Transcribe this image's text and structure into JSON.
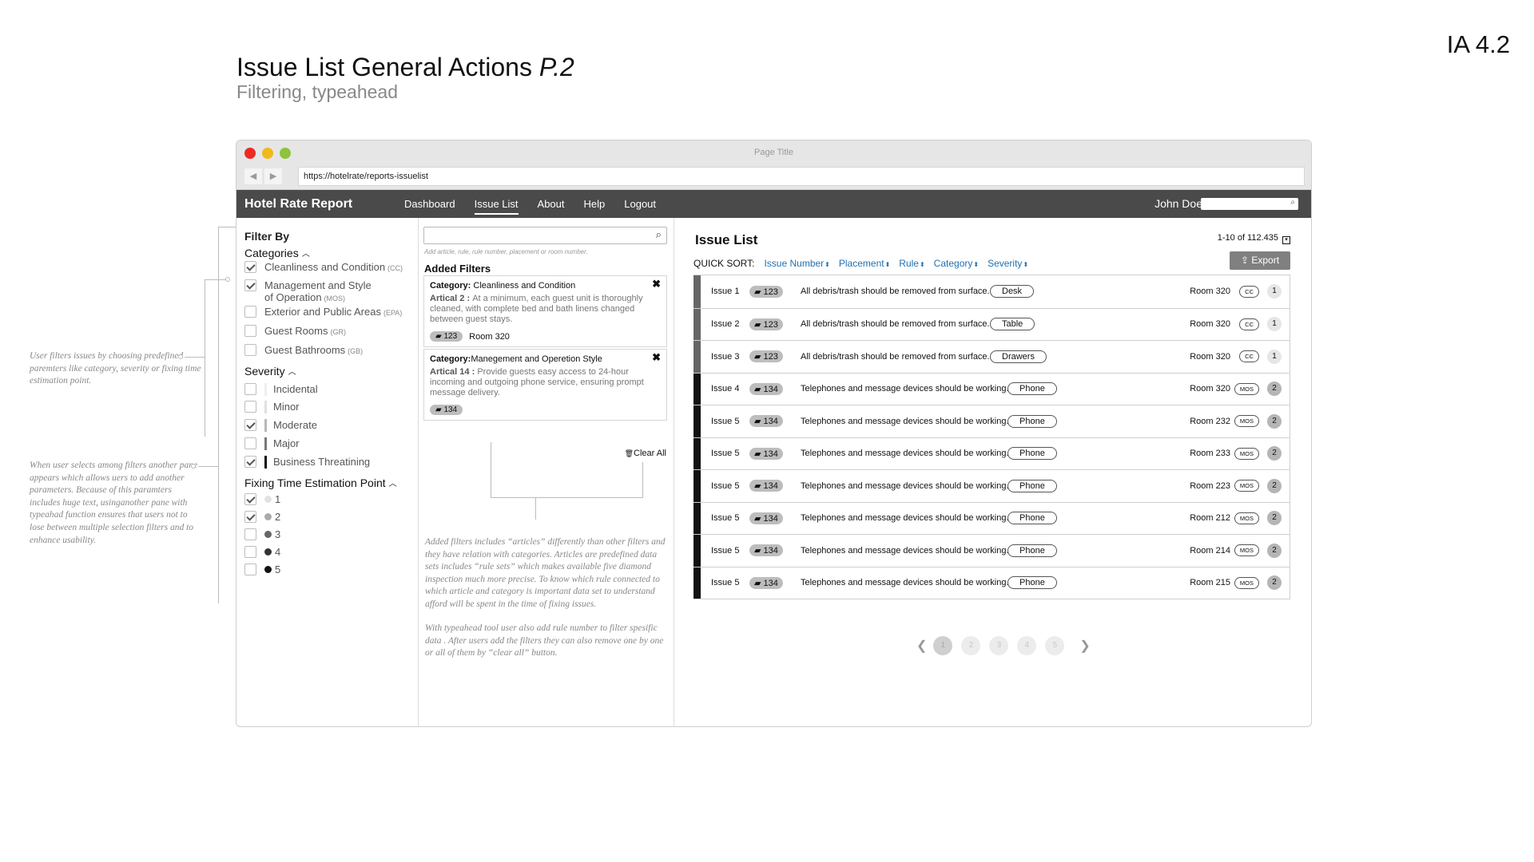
{
  "header": {
    "ia_tag": "IA 4.2",
    "title_main": "Issue List General Actions ",
    "title_page": "P.2",
    "subtitle": "Filtering, typeahead"
  },
  "browser": {
    "window_title": "Page Title",
    "url": "https://hotelrate/reports-issuelist",
    "back_icon": "◀",
    "forward_icon": "▶"
  },
  "app": {
    "brand": "Hotel Rate Report",
    "nav": [
      "Dashboard",
      "Issue List",
      "About",
      "Help",
      "Logout"
    ],
    "active_nav": "Issue List",
    "user": "John Doe",
    "search_icon": "⌕",
    "bg": "#4a4a4a"
  },
  "filters": {
    "title": "Filter By",
    "categories_label": "Categories",
    "categories": [
      {
        "label": "Cleanliness and Condition",
        "abbr": "(CC)",
        "checked": true
      },
      {
        "label": "Management and Style",
        "label2": "of Operation",
        "abbr": "(MOS)",
        "checked": true
      },
      {
        "label": "Exterior and Public Areas",
        "abbr": "(EPA)",
        "checked": false
      },
      {
        "label": "Guest Rooms",
        "abbr": "(GR)",
        "checked": false
      },
      {
        "label": "Guest Bathrooms",
        "abbr": "(GB)",
        "checked": false
      }
    ],
    "severity_label": "Severity",
    "severity": [
      {
        "label": "Incidental",
        "checked": false,
        "color": "#eeeeee"
      },
      {
        "label": "Minor",
        "checked": false,
        "color": "#e0e0e0"
      },
      {
        "label": "Moderate",
        "checked": true,
        "color": "#b8b8b8"
      },
      {
        "label": "Major",
        "checked": false,
        "color": "#777777"
      },
      {
        "label": "Business Threatining",
        "checked": true,
        "color": "#111111"
      }
    ],
    "time_label": "Fixing Time Estimation Point",
    "time_points": [
      {
        "label": "1",
        "checked": true,
        "color": "#e2e2e2"
      },
      {
        "label": "2",
        "checked": true,
        "color": "#aaaaaa"
      },
      {
        "label": "3",
        "checked": false,
        "color": "#666666"
      },
      {
        "label": "4",
        "checked": false,
        "color": "#333333"
      },
      {
        "label": "5",
        "checked": false,
        "color": "#111111"
      }
    ]
  },
  "added_filters": {
    "search_hint": "Add article, rule, rule number, placement or room number.",
    "title": "Added Filters",
    "cards": [
      {
        "category_prefix": "Category: ",
        "category": "Cleanliness and Condition",
        "article_prefix": "Artical 2 : ",
        "article": "At a minimum, each guest unit is thoroughly cleaned, with complete bed and bath linens changed between guest stays.",
        "rule": "123",
        "room": "Room 320"
      },
      {
        "category_prefix": "Category:",
        "category": "Manegement and Operetion Style",
        "article_prefix": "Artical 14 : ",
        "article": "Provide guests easy access to 24-hour incoming and outgoing phone service, ensuring prompt message delivery.",
        "rule": "134",
        "room": ""
      }
    ],
    "close_icon": "✖",
    "clear_all": "Clear All",
    "trash_icon": "🗑",
    "note_p1": "Added filters includes “articles”  differently than other filters and they have relation with categories. Articles are predefined data sets includes “rule sets” which makes available five diamond inspection much more precise. To know which rule connected to which article and category is important data set to understand afford will be spent in the time of fixing issues.",
    "note_p2": "With typeahead tool user also add rule number to filter spesific data . After users add the filters they can also remove one by one or all of them by “clear all” button."
  },
  "issue_list": {
    "title": "Issue List",
    "count": "1-10 of 112.435",
    "quick_sort_label": "QUICK SORT:",
    "sort_fields": [
      "Issue Number",
      "Placement",
      "Rule",
      "Category",
      "Severity"
    ],
    "sort_icon": "⬍",
    "export_label": "Export",
    "export_icon": "⇪",
    "book_icon": "▰",
    "rows": [
      {
        "issue": "Issue 1",
        "rule": "123",
        "desc": "All debris/trash should be removed from surface.",
        "placement": "Desk",
        "room": "Room 320",
        "cat": "CC",
        "time": "1",
        "sev_color": "#666666"
      },
      {
        "issue": "Issue 2",
        "rule": "123",
        "desc": "All debris/trash should be removed from surface.",
        "placement": "Table",
        "room": "Room 320",
        "cat": "CC",
        "time": "1",
        "sev_color": "#666666"
      },
      {
        "issue": "Issue 3",
        "rule": "123",
        "desc": "All debris/trash should be removed from surface.",
        "placement": "Drawers",
        "room": "Room 320",
        "cat": "CC",
        "time": "1",
        "sev_color": "#666666"
      },
      {
        "issue": "Issue 4",
        "rule": "134",
        "desc": "Telephones and message devices should be working.",
        "placement": "Phone",
        "room": "Room 320",
        "cat": "MOS",
        "time": "2",
        "sev_color": "#111111"
      },
      {
        "issue": "Issue 5",
        "rule": "134",
        "desc": "Telephones and message devices should be working.",
        "placement": "Phone",
        "room": "Room 232",
        "cat": "MOS",
        "time": "2",
        "sev_color": "#111111"
      },
      {
        "issue": "Issue 5",
        "rule": "134",
        "desc": "Telephones and message devices should be working.",
        "placement": "Phone",
        "room": "Room 233",
        "cat": "MOS",
        "time": "2",
        "sev_color": "#111111"
      },
      {
        "issue": "Issue 5",
        "rule": "134",
        "desc": "Telephones and message devices should be working.",
        "placement": "Phone",
        "room": "Room 223",
        "cat": "MOS",
        "time": "2",
        "sev_color": "#111111"
      },
      {
        "issue": "Issue 5",
        "rule": "134",
        "desc": "Telephones and message devices should be working.",
        "placement": "Phone",
        "room": "Room 212",
        "cat": "MOS",
        "time": "2",
        "sev_color": "#111111"
      },
      {
        "issue": "Issue 5",
        "rule": "134",
        "desc": "Telephones and message devices should be working.",
        "placement": "Phone",
        "room": "Room 214",
        "cat": "MOS",
        "time": "2",
        "sev_color": "#111111"
      },
      {
        "issue": "Issue 5",
        "rule": "134",
        "desc": "Telephones and message devices should be working.",
        "placement": "Phone",
        "room": "Room 215",
        "cat": "MOS",
        "time": "2",
        "sev_color": "#111111"
      }
    ],
    "pages": [
      "1",
      "2",
      "3",
      "4",
      "5"
    ],
    "current_page": "1",
    "prev_icon": "❮",
    "next_icon": "❯"
  },
  "annotations": {
    "note1": "User filters issues by choosing predefined paremters like category, severity or fixing time estimation point.",
    "note2": "When user selects among filters another pane appears which allows uers to add another parameters. Because of this paramters includes huge text, usinganother pane with typeahad function ensures that users not to lose between multiple selection filters and to enhance usability."
  }
}
